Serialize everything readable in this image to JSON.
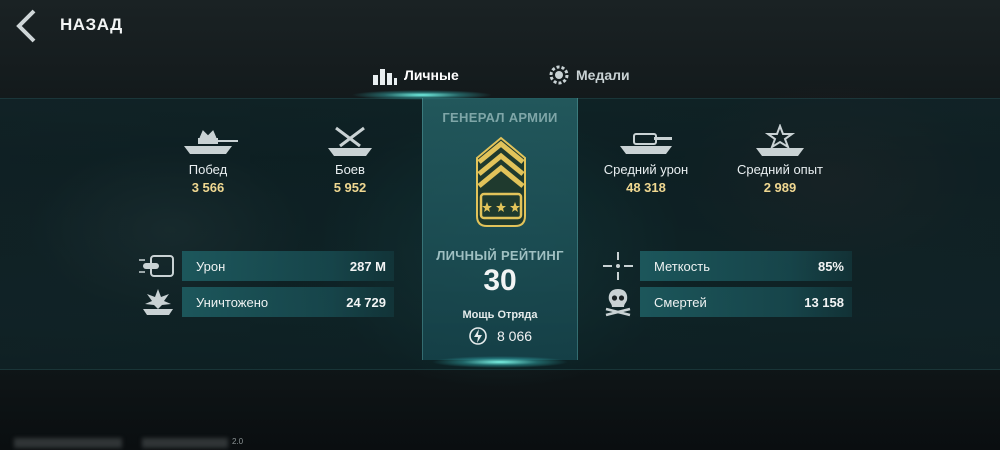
{
  "header": {
    "back_label": "НАЗАД"
  },
  "tabs": [
    {
      "label": "Личные",
      "icon": "bar-chart-icon",
      "active": true
    },
    {
      "label": "Медали",
      "icon": "medal-gear-icon",
      "active": false
    }
  ],
  "rank": {
    "title": "ГЕНЕРАЛ АРМИИ",
    "rating_label": "ЛИЧНЫЙ РЕЙТИНГ",
    "rating_value": "30",
    "power_label": "Мощь Отряда",
    "power_value": "8 066"
  },
  "stats_top_left": [
    {
      "label": "Побед",
      "value": "3 566",
      "icon": "tank-crown-icon"
    },
    {
      "label": "Боев",
      "value": "5 952",
      "icon": "crossed-swords-icon"
    }
  ],
  "stats_top_right": [
    {
      "label": "Средний урон",
      "value": "48 318",
      "icon": "tank-damage-icon"
    },
    {
      "label": "Средний опыт",
      "value": "2 989",
      "icon": "tank-star-icon"
    }
  ],
  "bars_left": [
    {
      "label": "Урон",
      "value": "287 М",
      "icon": "shell-hit-icon"
    },
    {
      "label": "Уничтожено",
      "value": "24 729",
      "icon": "tank-explosion-icon"
    }
  ],
  "bars_right": [
    {
      "label": "Меткость",
      "value": "85%",
      "icon": "crosshair-icon"
    },
    {
      "label": "Смертей",
      "value": "13 158",
      "icon": "skull-icon"
    }
  ],
  "footer": {
    "version": "2.0"
  },
  "colors": {
    "accent": "#6fe8dc",
    "value_gold": "#f0d891",
    "panel_teal": "#2a6a70",
    "insignia_gold": "#e2c35a"
  }
}
